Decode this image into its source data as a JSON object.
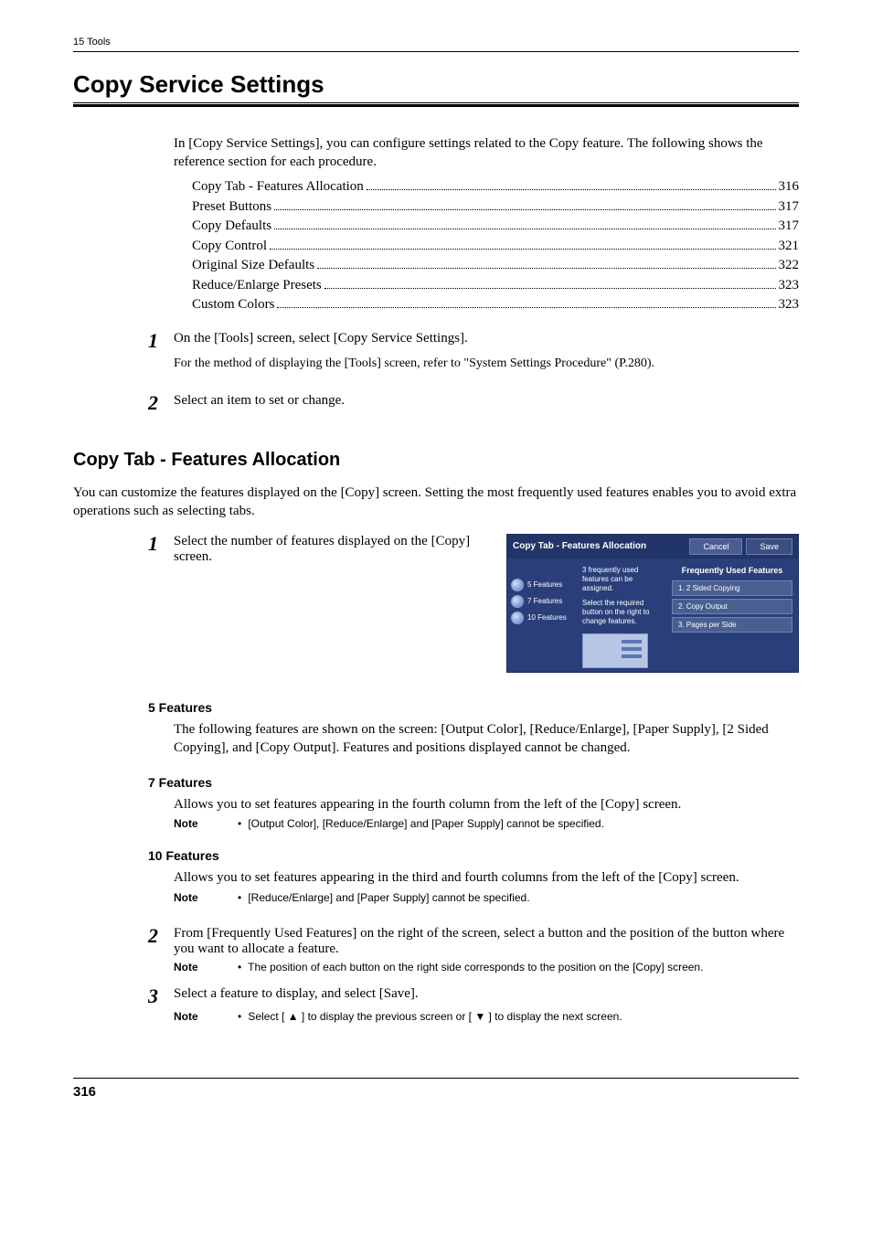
{
  "header": "15 Tools",
  "h1": "Copy Service Settings",
  "intro": "In [Copy Service Settings], you can configure settings related to the Copy feature. The following shows the reference section for each procedure.",
  "toc": [
    {
      "label": "Copy Tab - Features Allocation",
      "page": "316"
    },
    {
      "label": "Preset Buttons",
      "page": "317"
    },
    {
      "label": "Copy Defaults",
      "page": "317"
    },
    {
      "label": "Copy Control",
      "page": "321"
    },
    {
      "label": "Original Size Defaults",
      "page": "322"
    },
    {
      "label": "Reduce/Enlarge Presets",
      "page": "323"
    },
    {
      "label": "Custom Colors",
      "page": "323"
    }
  ],
  "steps_top": [
    {
      "num": "1",
      "text": "On the [Tools] screen, select [Copy Service Settings].",
      "sub": "For the method of displaying the [Tools] screen, refer to \"System Settings Procedure\" (P.280)."
    },
    {
      "num": "2",
      "text": "Select an item to set or change."
    }
  ],
  "h2": "Copy Tab - Features Allocation",
  "h2_intro": "You can customize the features displayed on the [Copy] screen. Setting the most frequently used features enables you to avoid extra operations such as selecting tabs.",
  "step_select": {
    "num": "1",
    "text": "Select the number of features displayed on the [Copy] screen."
  },
  "mock": {
    "title": "Copy Tab - Features Allocation",
    "cancel": "Cancel",
    "save": "Save",
    "radios": [
      "5 Features",
      "7 Features",
      "10 Features"
    ],
    "hint1": "3 frequently used features can be assigned.",
    "hint2": "Select the required button on the right to change features.",
    "col3_head": "Frequently Used Features",
    "items": [
      "1. 2 Sided Copying",
      "2. Copy Output",
      "3. Pages per Side"
    ]
  },
  "sections": [
    {
      "title": "5 Features",
      "text": "The following features are shown on the screen: [Output Color], [Reduce/Enlarge], [Paper Supply], [2 Sided Copying], and [Copy Output]. Features and positions displayed cannot be changed."
    },
    {
      "title": "7 Features",
      "text": "Allows you to set features appearing in the fourth column from the left of the [Copy] screen.",
      "note": "[Output Color], [Reduce/Enlarge] and [Paper Supply] cannot be specified."
    },
    {
      "title": "10 Features",
      "text": "Allows you to set features appearing in the third and fourth columns from the left of the [Copy] screen.",
      "note": "[Reduce/Enlarge] and [Paper Supply] cannot be specified."
    }
  ],
  "steps_bottom": [
    {
      "num": "2",
      "text": "From [Frequently Used Features] on the right of the screen, select a button and the position of the button where you want to allocate a feature.",
      "note": "The position of each button on the right side corresponds to the position on the [Copy] screen."
    },
    {
      "num": "3",
      "text": "Select a feature to display, and select [Save].",
      "note": "Select [ ▲ ] to display the previous screen or [ ▼ ] to display the next screen."
    }
  ],
  "note_label": "Note",
  "bullet": "•",
  "footer_page": "316"
}
